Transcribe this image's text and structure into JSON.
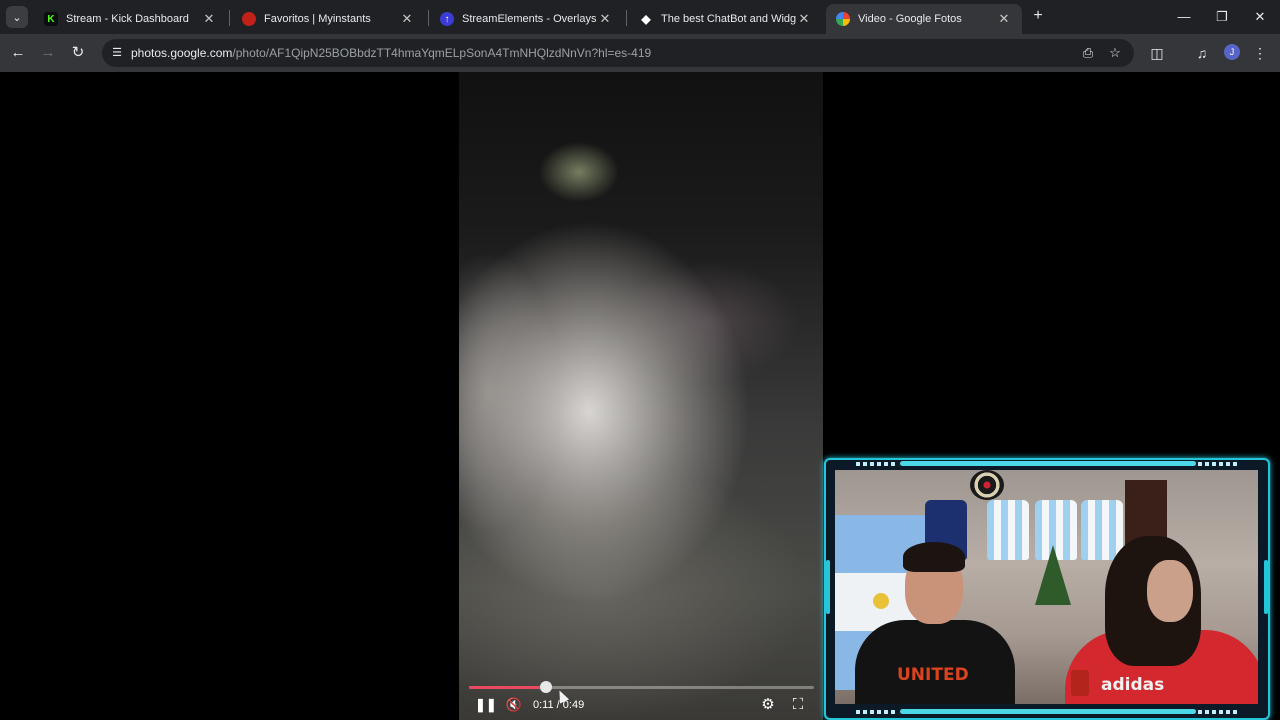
{
  "browser": {
    "tabs": [
      {
        "title": "Stream - Kick Dashboard",
        "favicon": "kick-icon",
        "color": "#53fc18"
      },
      {
        "title": "Favoritos | Myinstants",
        "favicon": "myinstants-icon",
        "color": "#c0221a"
      },
      {
        "title": "StreamElements - Overlays",
        "favicon": "streamelements-icon",
        "color": "#3b3bd6"
      },
      {
        "title": "The best ChatBot and Widgets",
        "favicon": "diamond-icon",
        "color": "#ffffff"
      },
      {
        "title": "Video - Google Fotos",
        "favicon": "google-photos-icon",
        "color": "#f4b400",
        "active": true
      }
    ],
    "address": {
      "host": "photos.google.com",
      "path": "/photo/AF1QipN25BOBbdzTT4hmaYqmELpSonA4TmNHQlzdNnVn?hl=es-419"
    },
    "profile_initial": "J"
  },
  "video": {
    "current_time": "0:11",
    "separator": "/",
    "duration": "0:49",
    "progress": 0.2245,
    "muted": true,
    "playing": true,
    "accent": "#e94a62"
  },
  "overlay": {
    "accent": "#26c6da",
    "shirt_text_left": "UNITED",
    "shirt_text_right": "adidas"
  }
}
